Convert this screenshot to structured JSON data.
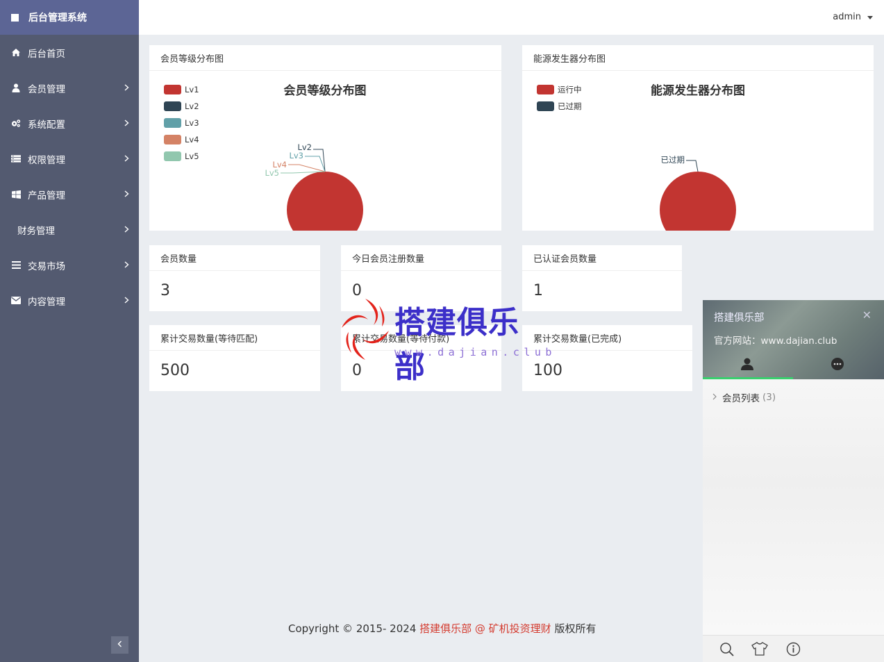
{
  "app": {
    "title": "后台管理系统"
  },
  "topbar": {
    "user": "admin"
  },
  "sidebar": {
    "items": [
      {
        "label": "后台首页",
        "icon": "home-icon",
        "has_children": false
      },
      {
        "label": "会员管理",
        "icon": "user-icon",
        "has_children": true
      },
      {
        "label": "系统配置",
        "icon": "gears-icon",
        "has_children": true
      },
      {
        "label": "权限管理",
        "icon": "list-icon",
        "has_children": true
      },
      {
        "label": "产品管理",
        "icon": "windows-icon",
        "has_children": true
      },
      {
        "label": "财务管理",
        "icon": "",
        "has_children": true
      },
      {
        "label": "交易市场",
        "icon": "bars-icon",
        "has_children": true
      },
      {
        "label": "内容管理",
        "icon": "envelope-icon",
        "has_children": true
      }
    ]
  },
  "panels": {
    "member_level_chart": {
      "header": "会员等级分布图"
    },
    "generator_chart": {
      "header": "能源发生器分布图"
    },
    "member_count": {
      "label": "会员数量",
      "value": "3"
    },
    "today_register": {
      "label": "今日会员注册数量",
      "value": "0"
    },
    "verified_count": {
      "label": "已认证会员数量",
      "value": "1"
    },
    "trade_waiting": {
      "label": "累计交易数量(等待匹配)",
      "value": "500"
    },
    "trade_paying": {
      "label": "累计交易数量(等待付款)",
      "value": "0"
    },
    "trade_done": {
      "label": "累计交易数量(已完成)",
      "value": "100"
    }
  },
  "chart_data": [
    {
      "type": "pie",
      "title": "会员等级分布图",
      "categories": [
        "Lv1",
        "Lv2",
        "Lv3",
        "Lv4",
        "Lv5"
      ],
      "values": [
        3,
        0,
        0,
        0,
        0
      ],
      "colors": [
        "#c23531",
        "#2f4554",
        "#61a0a8",
        "#d48265",
        "#91c7ae"
      ],
      "legend": "top-left"
    },
    {
      "type": "pie",
      "title": "能源发生器分布图",
      "categories": [
        "运行中",
        "已过期"
      ],
      "values": [
        1,
        0
      ],
      "colors": [
        "#c23531",
        "#2f4554"
      ],
      "legend": "top-left"
    }
  ],
  "watermark": {
    "text": "搭建俱乐部",
    "url": "www.dajian.club"
  },
  "footer": {
    "prefix": "Copyright © 2015- 2024 ",
    "link": "搭建俱乐部 @ 矿机投资理财",
    "suffix": " 版权所有"
  },
  "chat": {
    "title": "搭建俱乐部",
    "site": "官方网站：www.dajian.club",
    "group_label": "会员列表",
    "group_count": "(3)"
  },
  "colors": {
    "sidebar_bg": "#535a70",
    "sidebar_header": "#5c6595",
    "accent_red": "#c23531",
    "chat_green": "#39d06e"
  }
}
